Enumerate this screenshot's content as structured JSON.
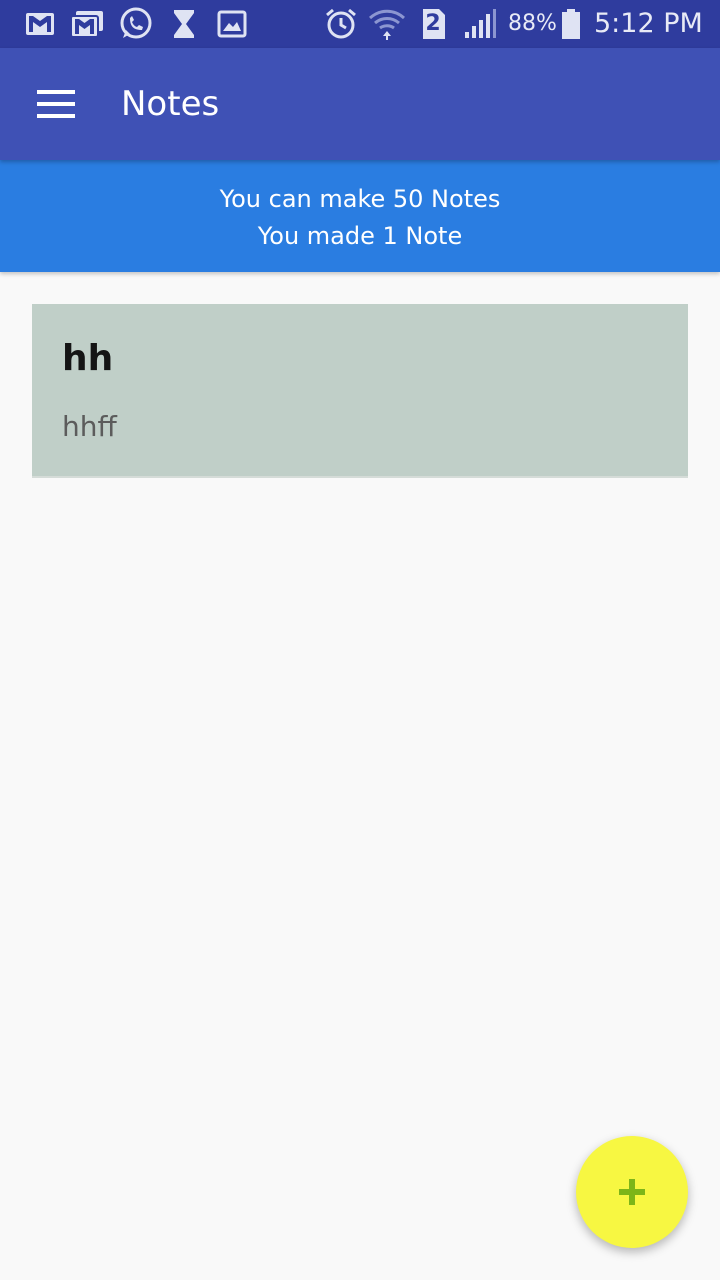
{
  "status_bar": {
    "battery_percent": "88%",
    "time": "5:12 PM",
    "sim_slot": "2",
    "icons": [
      "gmail-icon",
      "gmail-icon",
      "whatsapp-icon",
      "hourglass-icon",
      "gallery-icon",
      "alarm-icon",
      "wifi-icon",
      "sim-icon",
      "signal-icon",
      "battery-icon"
    ],
    "battery_level": 0.88
  },
  "app_bar": {
    "title": "Notes",
    "menu_icon": "hamburger-menu-icon",
    "color": "#3f51b5"
  },
  "banner": {
    "line1": "You can make 50 Notes",
    "line2": "You made 1 Note",
    "color": "#2a7de1"
  },
  "notes": [
    {
      "title": "hh",
      "body": "hhff",
      "color": "#c0cfc8"
    }
  ],
  "fab": {
    "icon": "plus-icon",
    "color": "#f7f742",
    "icon_color": "#7cb518"
  }
}
